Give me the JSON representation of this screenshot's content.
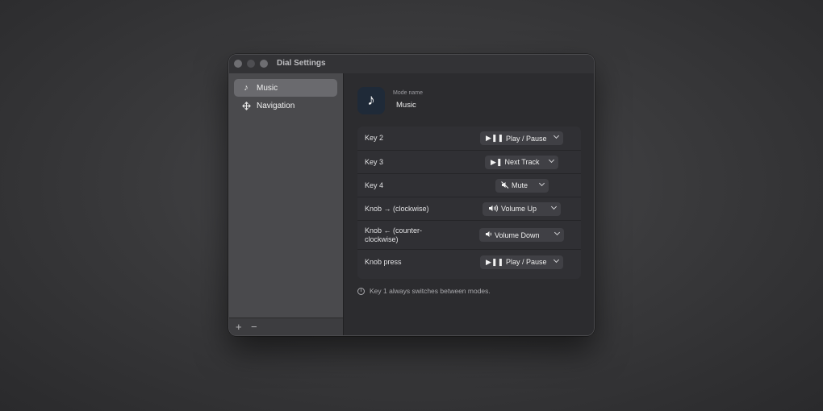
{
  "window": {
    "title": "Dial Settings"
  },
  "sidebar": {
    "items": [
      {
        "label": "Music",
        "icon": "music-note-icon",
        "selected": true
      },
      {
        "label": "Navigation",
        "icon": "move-arrows-icon",
        "selected": false
      }
    ],
    "add_label": "+",
    "remove_label": "−"
  },
  "mode": {
    "label": "Mode name",
    "value": "Music",
    "icon": "music-note-icon"
  },
  "mappings": [
    {
      "input": "Key 2",
      "action": "Play / Pause",
      "action_icon": "play-pause-icon"
    },
    {
      "input": "Key 3",
      "action": "Next Track",
      "action_icon": "next-track-icon"
    },
    {
      "input": "Key 4",
      "action": "Mute",
      "action_icon": "mute-icon"
    },
    {
      "input": "Knob →  (clockwise)",
      "action": "Volume Up",
      "action_icon": "volume-up-icon"
    },
    {
      "input": "Knob ←  (counter-clockwise)",
      "action": "Volume Down",
      "action_icon": "volume-down-icon"
    },
    {
      "input": "Knob press",
      "action": "Play / Pause",
      "action_icon": "play-pause-icon"
    }
  ],
  "footnote": "Key 1 always switches between modes."
}
